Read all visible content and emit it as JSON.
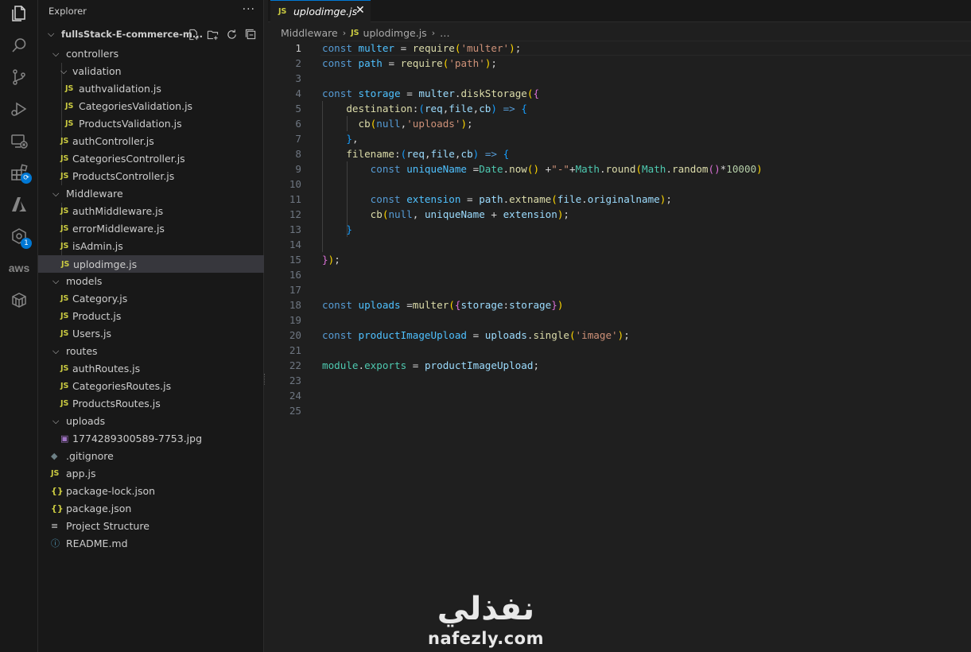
{
  "sidebar": {
    "title": "Explorer",
    "more": "···",
    "project_name": "fullsStack-E-commerce-m...",
    "tree": [
      {
        "label": "controllers",
        "type": "folder",
        "depth": 1
      },
      {
        "label": "validation",
        "type": "folder",
        "depth": 2
      },
      {
        "label": "authvalidation.js",
        "type": "js",
        "depth": 3
      },
      {
        "label": "CategoriesValidation.js",
        "type": "js",
        "depth": 3
      },
      {
        "label": "ProductsValidation.js",
        "type": "js",
        "depth": 3
      },
      {
        "label": "authController.js",
        "type": "js",
        "depth": 2
      },
      {
        "label": "CategoriesController.js",
        "type": "js",
        "depth": 2
      },
      {
        "label": "ProductsController.js",
        "type": "js",
        "depth": 2
      },
      {
        "label": "Middleware",
        "type": "folder",
        "depth": 1
      },
      {
        "label": "authMiddleware.js",
        "type": "js",
        "depth": 2
      },
      {
        "label": "errorMiddleware.js",
        "type": "js",
        "depth": 2
      },
      {
        "label": "isAdmin.js",
        "type": "js",
        "depth": 2
      },
      {
        "label": "uplodimge.js",
        "type": "js",
        "depth": 2,
        "selected": true
      },
      {
        "label": "models",
        "type": "folder",
        "depth": 1
      },
      {
        "label": "Category.js",
        "type": "js",
        "depth": 2
      },
      {
        "label": "Product.js",
        "type": "js",
        "depth": 2
      },
      {
        "label": "Users.js",
        "type": "js",
        "depth": 2
      },
      {
        "label": "routes",
        "type": "folder",
        "depth": 1
      },
      {
        "label": "authRoutes.js",
        "type": "js",
        "depth": 2
      },
      {
        "label": "CategoriesRoutes.js",
        "type": "js",
        "depth": 2
      },
      {
        "label": "ProductsRoutes.js",
        "type": "js",
        "depth": 2
      },
      {
        "label": "uploads",
        "type": "folder",
        "depth": 1
      },
      {
        "label": "1774289300589-7753.jpg",
        "type": "image",
        "depth": 2
      },
      {
        "label": ".gitignore",
        "type": "git",
        "depth": 1
      },
      {
        "label": "app.js",
        "type": "js",
        "depth": 1
      },
      {
        "label": "package-lock.json",
        "type": "json",
        "depth": 1
      },
      {
        "label": "package.json",
        "type": "json",
        "depth": 1
      },
      {
        "label": "Project Structure",
        "type": "text",
        "depth": 1
      },
      {
        "label": "README.md",
        "type": "info",
        "depth": 1
      }
    ]
  },
  "activity_bar": {
    "items": [
      "explorer-icon",
      "search-icon",
      "source-control-icon",
      "run-debug-icon",
      "remote-explorer-icon",
      "extensions-icon",
      "azure-icon",
      "extension-badge-icon",
      "aws-icon",
      "container-icon"
    ],
    "badge": "1",
    "aws_label": "aws"
  },
  "editor": {
    "tab": {
      "icon_text": "JS",
      "label": "uplodimge.js",
      "close": "✕"
    },
    "breadcrumb": {
      "folder": "Middleware",
      "sep": "›",
      "icon_text": "JS",
      "file": "uplodimge.js",
      "trail": "…"
    },
    "current_line": 1,
    "line_numbers": [
      "1",
      "2",
      "3",
      "4",
      "5",
      "6",
      "7",
      "8",
      "9",
      "10",
      "11",
      "12",
      "13",
      "14",
      "15",
      "16",
      "17",
      "18",
      "19",
      "20",
      "21",
      "22",
      "23",
      "24",
      "25"
    ]
  },
  "watermark": {
    "arabic": "نفذلي",
    "latin": "nafezly.com"
  },
  "colors": {
    "accent": "#0078d4",
    "js_icon": "#cbcb41",
    "keyword": "#569cd6",
    "variable": "#9cdcfe",
    "function": "#dcdcaa",
    "string": "#ce9178",
    "number": "#b5cea8"
  }
}
